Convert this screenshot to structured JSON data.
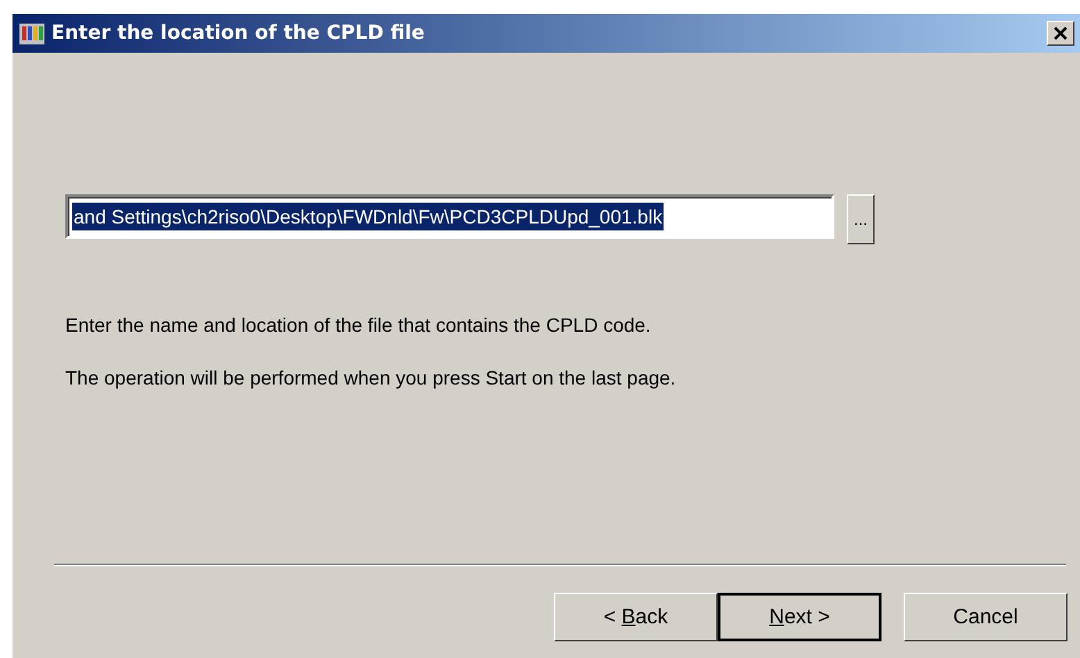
{
  "window": {
    "title": "Enter the location of the CPLD file"
  },
  "file_field": {
    "value": "and Settings\\ch2riso0\\Desktop\\FWDnld\\Fw\\PCD3CPLDUpd_001.blk",
    "selected": true
  },
  "browse_button": {
    "label": "..."
  },
  "messages": [
    "Enter the name and location of the file that contains the CPLD code.",
    "The operation will be performed when you press Start on the last page."
  ],
  "buttons": [
    {
      "before": "< ",
      "key": "B",
      "after": "ack",
      "default": false
    },
    {
      "key": "N",
      "after": "ext >",
      "default": true
    },
    {
      "before": "Cancel",
      "default": false
    }
  ]
}
